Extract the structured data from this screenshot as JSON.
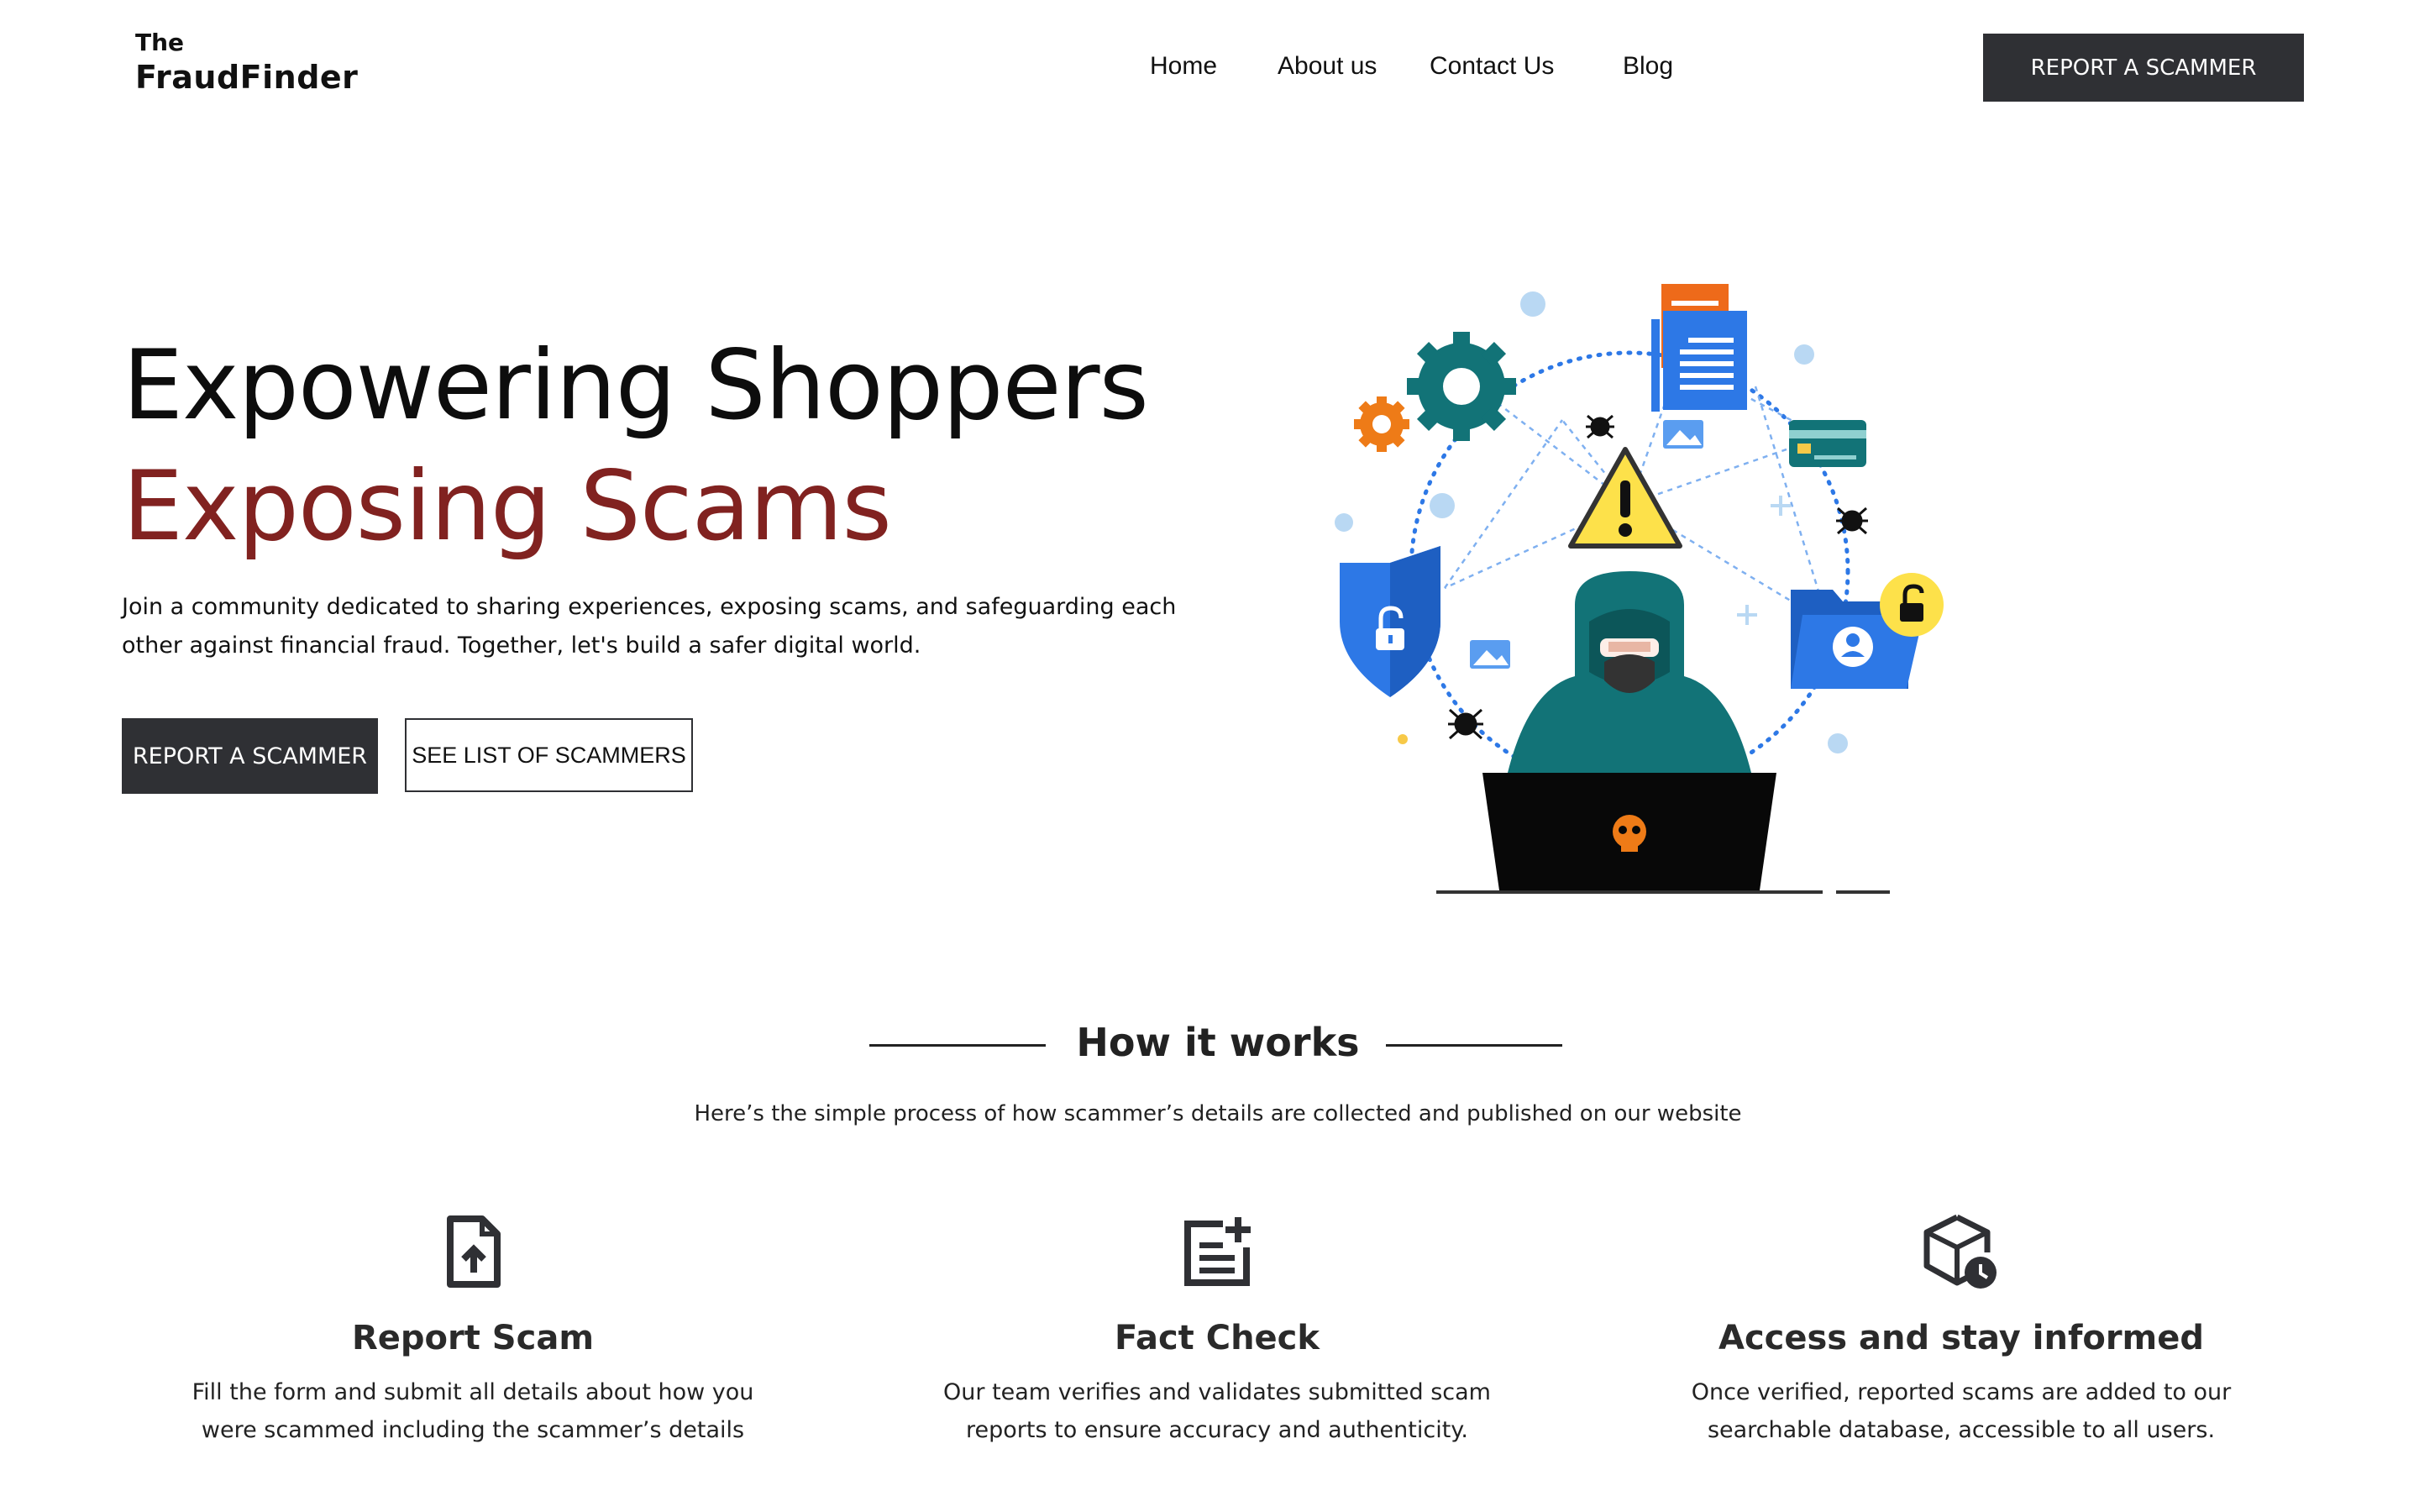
{
  "header": {
    "logo_top": "The",
    "logo_main": "FraudFinder",
    "nav": [
      "Home",
      "About us",
      "Contact Us",
      "Blog"
    ],
    "cta_label": "REPORT A SCAMMER"
  },
  "hero": {
    "title_line1": "Expowering Shoppers",
    "title_line2": "Exposing Scams",
    "description": "Join a community dedicated to sharing experiences, exposing scams, and safeguarding each other against financial fraud. Together, let's build a safer digital world.",
    "primary_button": "REPORT A SCAMMER",
    "secondary_button": "SEE LIST OF SCAMMERS"
  },
  "how_it_works": {
    "title": "How it works",
    "subtitle": "Here’s the simple process of how scammer’s details are collected and published on our website",
    "steps": [
      {
        "icon": "file-upload-icon",
        "title": "Report Scam",
        "desc_line1": "Fill the form and submit all details about how you",
        "desc_line2": "were scammed including the scammer’s details"
      },
      {
        "icon": "document-add-icon",
        "title": "Fact Check",
        "desc_line1": "Our team verifies and validates submitted scam",
        "desc_line2": "reports to ensure accuracy and authenticity."
      },
      {
        "icon": "box-clock-icon",
        "title": "Access and stay informed",
        "desc_line1": "Once verified, reported scams are added to our",
        "desc_line2": "searchable database, accessible to all users."
      }
    ]
  },
  "colors": {
    "accent_dark": "#2f3034",
    "hero_red": "#812220",
    "illustration_teal": "#127377",
    "illustration_blue": "#2d78e6",
    "illustration_orange": "#ee7b17",
    "illustration_yellow": "#fde14a"
  }
}
